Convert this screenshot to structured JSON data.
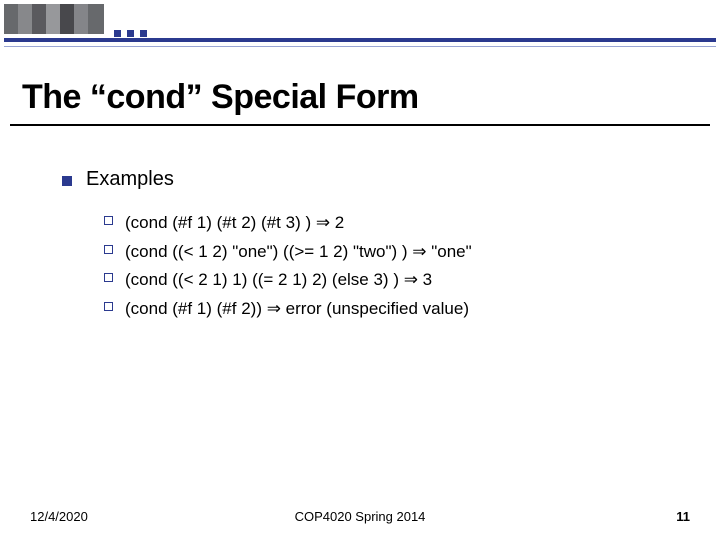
{
  "title": "The “cond” Special Form",
  "section_heading": "Examples",
  "items": [
    "(cond (#f 1) (#t 2) (#t 3) ) ⇒ 2",
    "(cond ((< 1 2) \"one\") ((>= 1 2) \"two\") ) ⇒ \"one\"",
    "(cond ((< 2 1) 1) ((= 2 1) 2) (else 3) ) ⇒ 3",
    "(cond (#f 1) (#f 2)) ⇒ error (unspecified value)"
  ],
  "footer": {
    "date": "12/4/2020",
    "course": "COP4020 Spring 2014",
    "page": "11"
  }
}
